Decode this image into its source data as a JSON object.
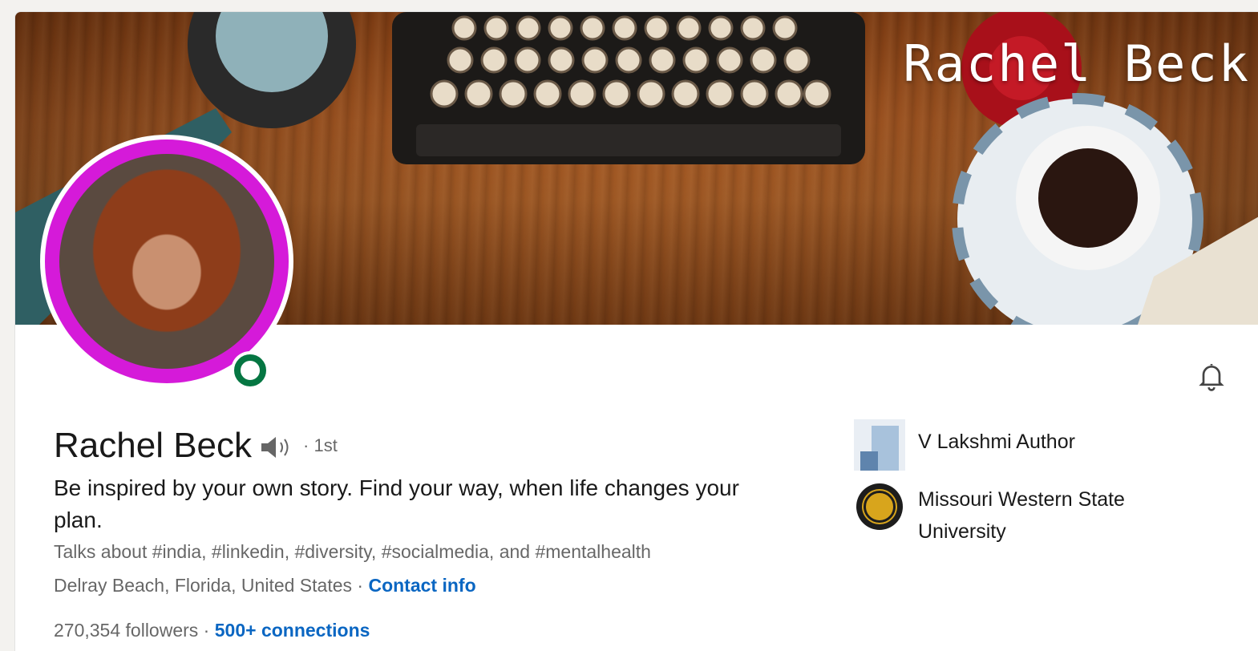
{
  "banner": {
    "title": "Rachel Beck"
  },
  "profile": {
    "name": "Rachel Beck",
    "degree": "· 1st",
    "headline": "Be inspired by your own story. Find your way, when life changes your plan.",
    "talks_about": "Talks about #india, #linkedin, #diversity, #socialmedia, and #mentalhealth",
    "location": "Delray Beach, Florida, United States",
    "location_separator": " · ",
    "contact_info_label": "Contact info",
    "followers": "270,354 followers",
    "stats_separator": " · ",
    "connections_label": "500+ connections"
  },
  "experience": {
    "company": "V Lakshmi Author",
    "school": "Missouri Western State University"
  },
  "colors": {
    "ring": "#d51ad9",
    "online": "#057642",
    "link": "#0a66c2"
  },
  "icons": [
    "speaker-icon",
    "bell-icon",
    "company-logo-icon",
    "school-logo-icon"
  ]
}
